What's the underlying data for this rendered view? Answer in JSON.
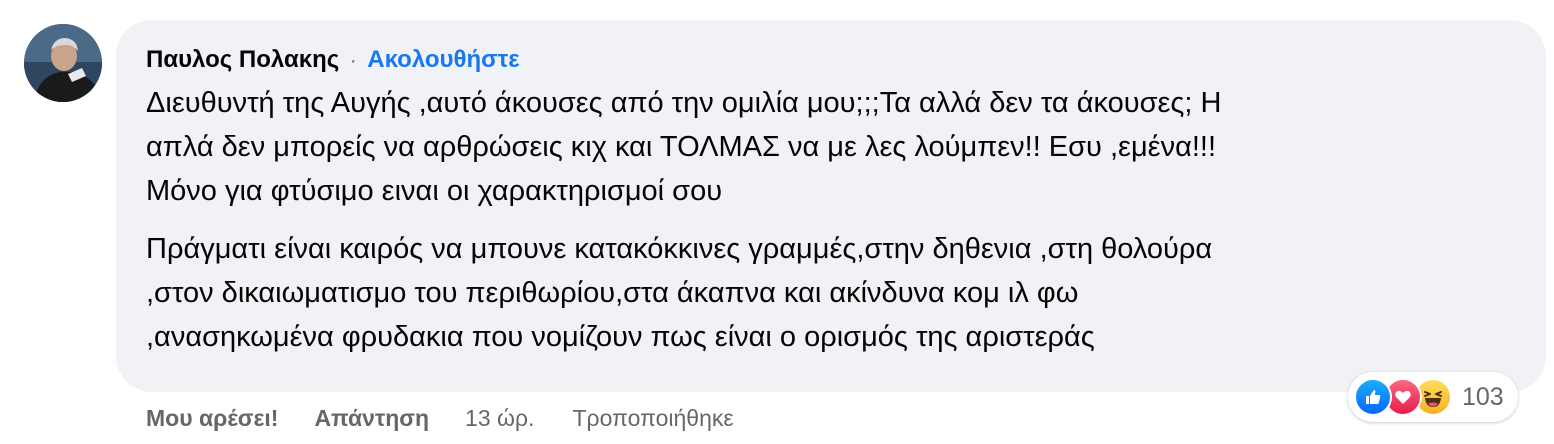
{
  "comment": {
    "author": "Παυλος Πολακης",
    "separator": "·",
    "follow_label": "Ακολουθήστε",
    "paragraphs": [
      {
        "lines": [
          "Διευθυντή της Αυγής ,αυτό άκουσες από την ομιλία μου;;;Τα αλλά δεν τα άκουσες; Η",
          "απλά δεν μπορείς να αρθρώσεις κιχ και ΤΟΛΜΑΣ να με λες λούμπεν!! Εσυ ,εμένα!!!",
          "Μόνο για φτύσιμο ειναι οι χαρακτηρισμοί σου"
        ]
      },
      {
        "lines": [
          "Πράγματι είναι καιρός να μπουνε κατακόκκινες γραμμές,στην δηθενια ,στη θολούρα",
          ",στον δικαιωματισμο του περιθωρίου,στα άκαπνα και ακίνδυνα κομ ιλ φω",
          ",ανασηκωμένα φρυδακια που νομίζουν πως είναι ο ορισμός της αριστεράς"
        ]
      }
    ]
  },
  "actions": {
    "like_label": "Μου αρέσει!",
    "reply_label": "Απάντηση",
    "time": "13 ώρ.",
    "edited_label": "Τροποποιήθηκε"
  },
  "reactions": {
    "icons": [
      "like-icon",
      "love-icon",
      "haha-icon"
    ],
    "count": "103"
  },
  "colors": {
    "bubble_bg": "#f0f2f5",
    "link_blue": "#1877f2",
    "secondary_text": "#65676b",
    "primary_text": "#050505"
  }
}
